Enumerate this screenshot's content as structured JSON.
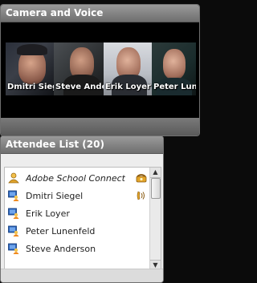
{
  "camera_panel": {
    "title": "Camera and Voice",
    "videos": [
      {
        "name": "Dmitri Siegel"
      },
      {
        "name": "Steve Anderson"
      },
      {
        "name": "Erik  Loyer"
      },
      {
        "name": "Peter Lunenfeld"
      }
    ]
  },
  "attendee_panel": {
    "title": "Attendee List (20)",
    "rows": [
      {
        "name": "Adobe School Connect",
        "role": "host",
        "right_icon": "phone-icon"
      },
      {
        "name": "Dmitri Siegel",
        "role": "presenter",
        "right_icon": "speaking-phone-icon"
      },
      {
        "name": "Erik  Loyer",
        "role": "participant",
        "right_icon": ""
      },
      {
        "name": "Peter Lunenfeld",
        "role": "participant",
        "right_icon": ""
      },
      {
        "name": "Steve Anderson",
        "role": "participant",
        "right_icon": ""
      }
    ]
  },
  "colors": {
    "header_gradient_top": "#9a9a9a",
    "header_gradient_bottom": "#6f6f6f",
    "host_icon": "#e0a32b",
    "participant_icon_blue": "#2b62b8",
    "participant_icon_orange": "#f08a1e"
  }
}
